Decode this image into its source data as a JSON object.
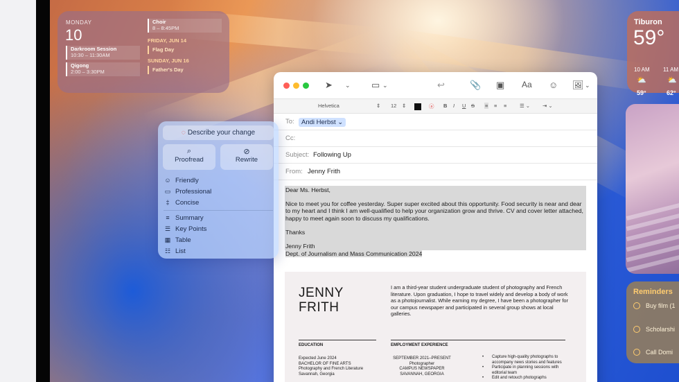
{
  "calendar": {
    "day_label": "MONDAY",
    "date": "10",
    "events_left": [
      {
        "title": "Darkroom Session",
        "time": "10:30 – 11:30AM"
      },
      {
        "title": "Qigong",
        "time": "2:00 – 3:30PM"
      }
    ],
    "event_top_right": {
      "title": "Choir",
      "time": "8 – 8:45PM"
    },
    "upcoming": [
      {
        "day": "FRIDAY, JUN 14",
        "event": "Flag Day"
      },
      {
        "day": "SUNDAY, JUN 16",
        "event": "Father's Day"
      }
    ]
  },
  "weather": {
    "city": "Tiburon",
    "temp": "59°",
    "hours": [
      {
        "time": "10 AM",
        "icon": "partly-sunny-icon",
        "temp": "59°"
      },
      {
        "time": "11 AM",
        "icon": "partly-sunny-icon",
        "temp": "62°"
      }
    ]
  },
  "reminders": {
    "title": "Reminders",
    "items": [
      "Buy film (1",
      "Scholarshi",
      "Call Domi"
    ]
  },
  "writing_tools": {
    "describe": "Describe your change",
    "proofread": "Proofread",
    "rewrite": "Rewrite",
    "tones": [
      "Friendly",
      "Professional",
      "Concise"
    ],
    "formats": [
      "Summary",
      "Key Points",
      "Table",
      "List"
    ]
  },
  "mail": {
    "format_bar": {
      "font": "Helvetica",
      "size": "12"
    },
    "to_label": "To:",
    "to_value": "Andi Herbst",
    "cc_label": "Cc:",
    "subject_label": "Subject:",
    "subject_value": "Following Up",
    "from_label": "From:",
    "from_value": "Jenny Frith",
    "body": {
      "greeting": "Dear Ms. Herbst,",
      "paragraph": "Nice to meet you for coffee yesterday. Super super excited about this opportunity. Food security is near and dear to my heart and I think I am well-qualified to help your organization grow and thrive. CV and cover letter attached, happy to meet again soon to discuss my qualifications.",
      "closing": "Thanks",
      "signature_name": "Jenny Frith",
      "signature_dept": "Dept. of Journalism and Mass Communication 2024"
    }
  },
  "resume": {
    "name_line1": "JENNY",
    "name_line2": "FRITH",
    "intro": "I am a third-year student undergraduate student of photography and French literature. Upon graduation, I hope to travel widely and develop a body of work as a photojournalist. While earning my degree, I have been a photographer for our campus newspaper and participated in several group shows at local galleries.",
    "education_heading": "EDUCATION",
    "education": [
      "Expected June 2024",
      "BACHELOR OF FINE ARTS",
      "Photography and French Literature",
      "Savannah, Georgia"
    ],
    "employment_heading": "EMPLOYMENT EXPERIENCE",
    "employment": [
      "SEPTEMBER 2021–PRESENT",
      "Photographer",
      "CAMPUS NEWSPAPER",
      "SAVANNAH, GEORGIA"
    ],
    "duties": [
      "Capture high-quality photographs to accompany news stories and features",
      "Participate in planning sessions with editorial team",
      "Edit and retouch photographs"
    ]
  }
}
